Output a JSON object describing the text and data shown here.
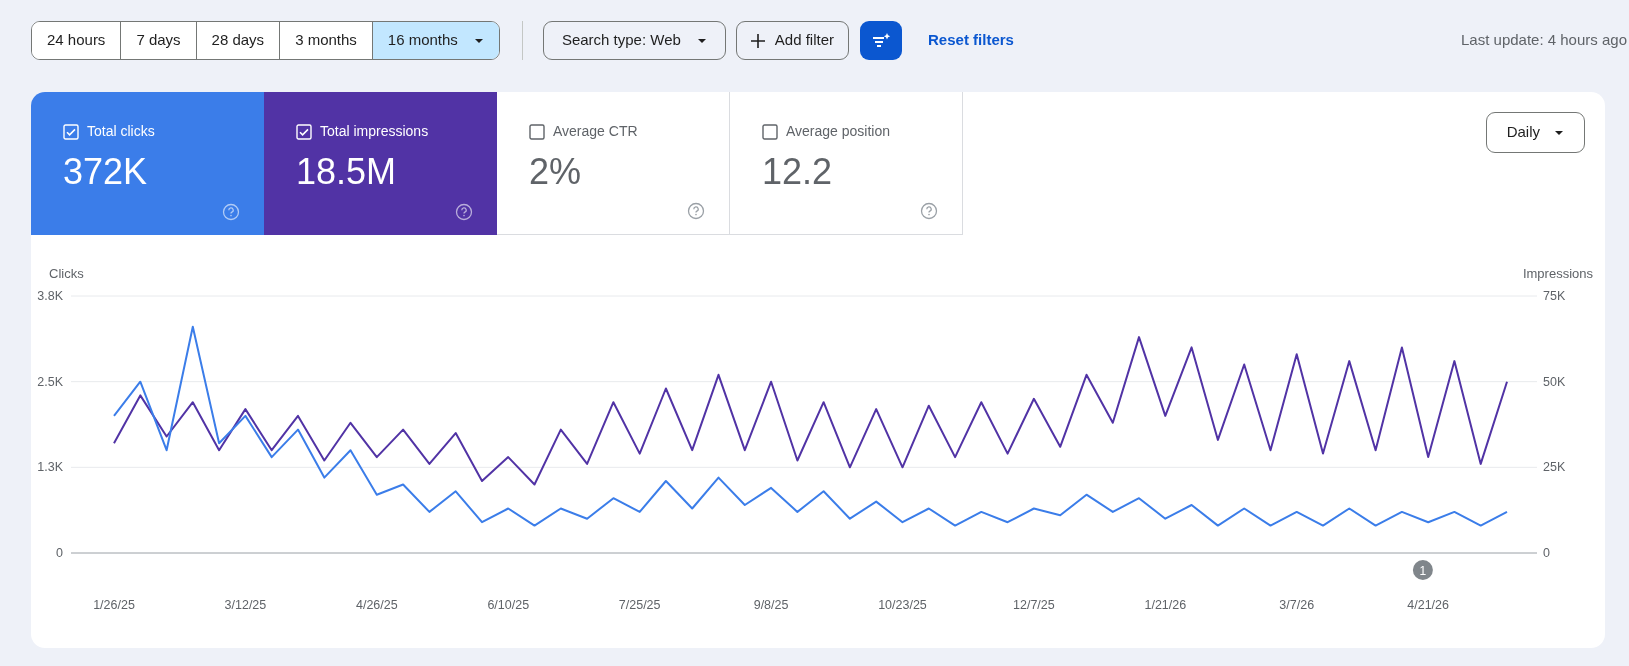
{
  "date_ranges": [
    {
      "label": "24 hours",
      "selected": false,
      "dropdown": false
    },
    {
      "label": "7 days",
      "selected": false,
      "dropdown": false
    },
    {
      "label": "28 days",
      "selected": false,
      "dropdown": false
    },
    {
      "label": "3 months",
      "selected": false,
      "dropdown": false
    },
    {
      "label": "16 months",
      "selected": true,
      "dropdown": true
    }
  ],
  "search_type": {
    "label": "Search type: Web"
  },
  "add_filter": {
    "label": "Add filter"
  },
  "reset_filters": {
    "label": "Reset filters"
  },
  "last_update": "Last update: 4 hours ago",
  "metrics": [
    {
      "label": "Total clicks",
      "value": "372K",
      "checked": true,
      "color": "#3b7de9"
    },
    {
      "label": "Total impressions",
      "value": "18.5M",
      "checked": true,
      "color": "#5133a5"
    },
    {
      "label": "Average CTR",
      "value": "2%",
      "checked": false
    },
    {
      "label": "Average position",
      "value": "12.2",
      "checked": false
    }
  ],
  "granularity": {
    "label": "Daily"
  },
  "chart": {
    "chart_data": {
      "type": "line",
      "ylabel": "Clicks",
      "y2label": "Impressions",
      "categories": [
        "1/26/25",
        null,
        null,
        null,
        null,
        "3/12/25",
        null,
        null,
        null,
        null,
        "4/26/25",
        null,
        null,
        null,
        null,
        "6/10/25",
        null,
        null,
        null,
        null,
        "7/25/25",
        null,
        null,
        null,
        null,
        "9/8/25",
        null,
        null,
        null,
        null,
        "10/23/25",
        null,
        null,
        null,
        null,
        "12/7/25",
        null,
        null,
        null,
        null,
        "1/21/26",
        null,
        null,
        null,
        null,
        "3/7/26",
        null,
        null,
        null,
        null,
        "4/21/26",
        null,
        null,
        null
      ],
      "ylim": [
        0,
        3750
      ],
      "yticks": [
        {
          "value": 0,
          "label": "0"
        },
        {
          "value": 1250,
          "label": "1.3K"
        },
        {
          "value": 2500,
          "label": "2.5K"
        },
        {
          "value": 3750,
          "label": "3.8K"
        }
      ],
      "y2lim": [
        0,
        75000
      ],
      "y2ticks": [
        {
          "value": 0,
          "label": "0"
        },
        {
          "value": 25000,
          "label": "25K"
        },
        {
          "value": 50000,
          "label": "50K"
        },
        {
          "value": 75000,
          "label": "75K"
        }
      ],
      "series": [
        {
          "color": "#3b7de9",
          "values": [
            2000,
            2500,
            1500,
            3300,
            1600,
            2000,
            1400,
            1800,
            1100,
            1500,
            850,
            1000,
            600,
            900,
            450,
            650,
            400,
            650,
            500,
            800,
            600,
            1050,
            650,
            1100,
            700,
            950,
            600,
            900,
            500,
            750,
            450,
            650,
            400,
            600,
            450,
            650,
            550,
            850,
            600,
            800,
            500,
            700,
            400,
            650,
            400,
            600,
            400,
            650,
            400,
            600,
            450,
            600,
            400,
            600
          ]
        },
        {
          "color": "#5133a5",
          "axis": "y2",
          "values": [
            32000,
            46000,
            34000,
            44000,
            30000,
            42000,
            30000,
            40000,
            27000,
            38000,
            28000,
            36000,
            26000,
            35000,
            21000,
            28000,
            20000,
            36000,
            26000,
            44000,
            29000,
            48000,
            30000,
            52000,
            30000,
            50000,
            27000,
            44000,
            25000,
            42000,
            25000,
            43000,
            28000,
            44000,
            29000,
            45000,
            31000,
            52000,
            38000,
            63000,
            40000,
            60000,
            33000,
            55000,
            30000,
            58000,
            29000,
            56000,
            30000,
            60000,
            28000,
            56000,
            26000,
            50000
          ]
        }
      ],
      "annotations": [
        "1"
      ]
    }
  }
}
